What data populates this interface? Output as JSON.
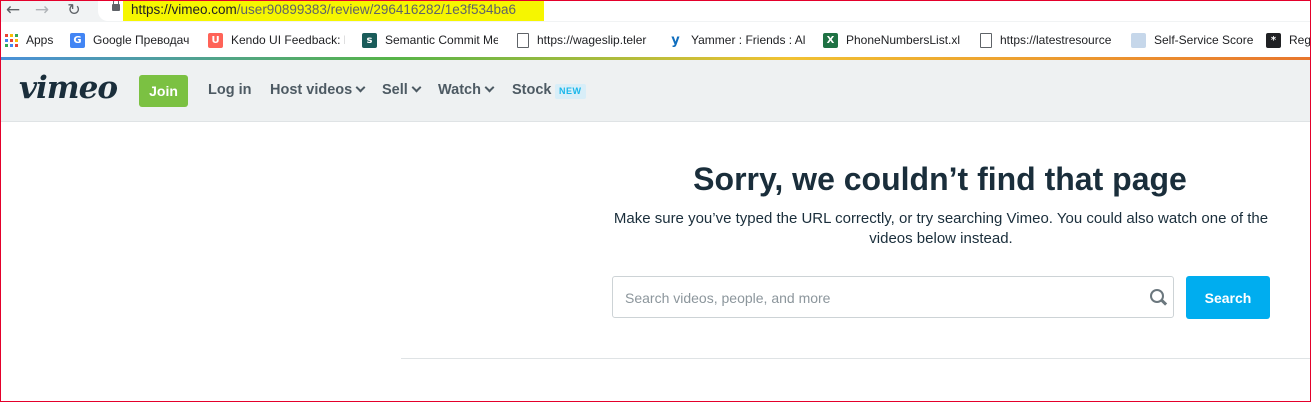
{
  "browser": {
    "back_icon": "arrow-left-icon",
    "forward_icon": "arrow-right-icon",
    "reload_icon": "reload-icon",
    "url_host": "https://vimeo.com",
    "url_path": "/user90899383/review/296416282/1e3f534ba6",
    "url_highlight_color": "#f6f600"
  },
  "bookmarks": [
    {
      "label": "Apps",
      "icon": "apps-grid-icon"
    },
    {
      "label": "Google Преводач",
      "icon": "google-translate-icon"
    },
    {
      "label": "Kendo UI Feedback: I",
      "icon": "kendo-icon"
    },
    {
      "label": "Semantic Commit Me",
      "icon": "semantic-icon"
    },
    {
      "label": "https://wageslip.teler",
      "icon": "page-icon"
    },
    {
      "label": "Yammer : Friends : All",
      "icon": "yammer-icon"
    },
    {
      "label": "PhoneNumbersList.xl",
      "icon": "excel-icon"
    },
    {
      "label": "https://latestresource",
      "icon": "page-icon"
    },
    {
      "label": "Self-Service Score",
      "icon": "document-icon"
    },
    {
      "label": "Reg",
      "icon": "star-black-icon"
    }
  ],
  "header": {
    "logo": "vimeo",
    "join_label": "Join",
    "login_label": "Log in",
    "host_label": "Host videos",
    "sell_label": "Sell",
    "watch_label": "Watch",
    "stock_label": "Stock",
    "stock_badge": "NEW",
    "join_color": "#7bc142"
  },
  "main": {
    "title": "Sorry, we couldn’t find that page",
    "subtitle": "Make sure you’ve typed the URL correctly, or try searching Vimeo. You could also watch one of the videos below instead.",
    "search_placeholder": "Search videos, people, and more",
    "search_value": "",
    "search_button": "Search",
    "search_button_color": "#00adef"
  }
}
